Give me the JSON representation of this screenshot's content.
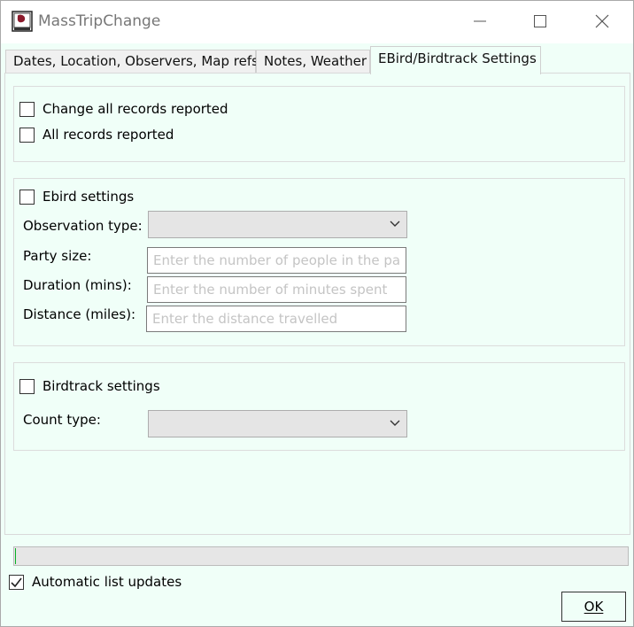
{
  "window": {
    "title": "MassTripChange",
    "app_icon": "book-icon",
    "controls": {
      "minimize": "minimize-icon",
      "maximize": "maximize-icon",
      "close": "close-icon"
    }
  },
  "tabs": [
    {
      "label": "Dates, Location, Observers, Map refs",
      "active": false
    },
    {
      "label": "Notes, Weather",
      "active": false
    },
    {
      "label": "EBird/Birdtrack Settings",
      "active": true
    }
  ],
  "records_group": {
    "change_all": {
      "label": "Change all records reported",
      "checked": false
    },
    "all_reported": {
      "label": "All records reported",
      "checked": false
    }
  },
  "ebird_group": {
    "enable": {
      "label": "Ebird settings",
      "checked": false
    },
    "observation_type": {
      "label": "Observation type:",
      "value": ""
    },
    "party_size": {
      "label": "Party size:",
      "placeholder": "Enter the number of people in the party"
    },
    "duration": {
      "label": "Duration (mins):",
      "placeholder": "Enter the number of minutes spent"
    },
    "distance": {
      "label": "Distance (miles):",
      "placeholder": "Enter the distance travelled"
    }
  },
  "birdtrack_group": {
    "enable": {
      "label": "Birdtrack settings",
      "checked": false
    },
    "count_type": {
      "label": "Count type:",
      "value": ""
    }
  },
  "progress": {
    "value": 0.002
  },
  "auto_updates": {
    "label": "Automatic list updates",
    "checked": true
  },
  "ok_button": {
    "label": "OK"
  }
}
